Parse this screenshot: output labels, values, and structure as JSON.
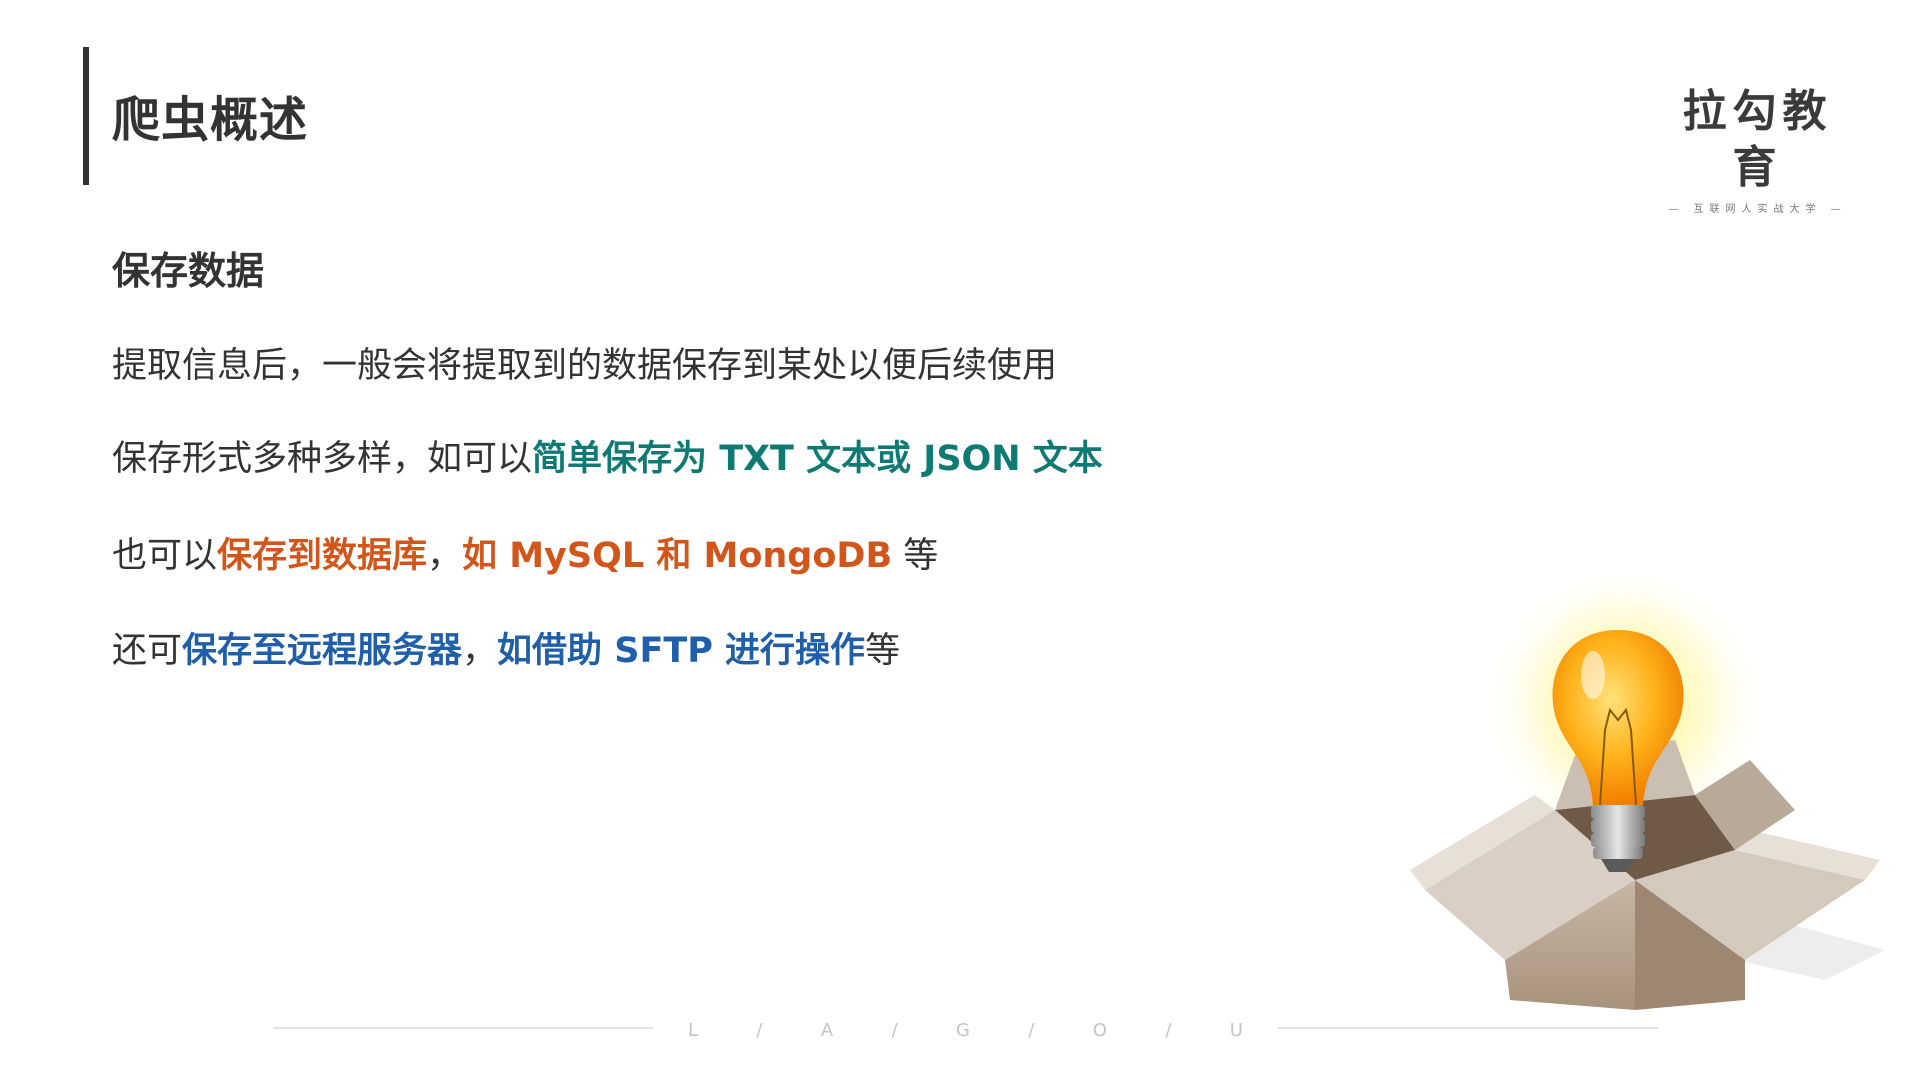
{
  "header": {
    "title": "爬虫概述"
  },
  "logo": {
    "main": "拉勾教育",
    "sub": "— 互联网人实战大学 —"
  },
  "section": {
    "heading": "保存数据"
  },
  "lines": [
    {
      "parts": [
        {
          "text": "提取信息后，一般会将提取到的数据保存到某处以便后续使用",
          "style": "normal"
        }
      ]
    },
    {
      "parts": [
        {
          "text": "保存形式多种多样，如可以",
          "style": "normal"
        },
        {
          "text": "简单保存为 TXT 文本或 JSON 文本",
          "style": "teal"
        }
      ]
    },
    {
      "parts": [
        {
          "text": "也可以",
          "style": "normal"
        },
        {
          "text": "保存到数据库",
          "style": "orange"
        },
        {
          "text": "，",
          "style": "normal"
        },
        {
          "text": "如 MySQL 和 MongoDB",
          "style": "orange"
        },
        {
          "text": " 等",
          "style": "normal"
        }
      ]
    },
    {
      "parts": [
        {
          "text": "还可",
          "style": "normal"
        },
        {
          "text": "保存至远程服务器",
          "style": "blue"
        },
        {
          "text": "，",
          "style": "normal"
        },
        {
          "text": "如借助 SFTP 进行操作",
          "style": "blue"
        },
        {
          "text": "等",
          "style": "normal"
        }
      ]
    }
  ],
  "footer": {
    "letters": [
      "L",
      "/",
      "A",
      "/",
      "G",
      "/",
      "O",
      "/",
      "U"
    ]
  },
  "colors": {
    "teal": "#0f7a73",
    "orange": "#d2561a",
    "blue": "#1f5ea8",
    "text": "#333333"
  },
  "illustration": {
    "icon": "lightbulb-in-box-icon"
  }
}
